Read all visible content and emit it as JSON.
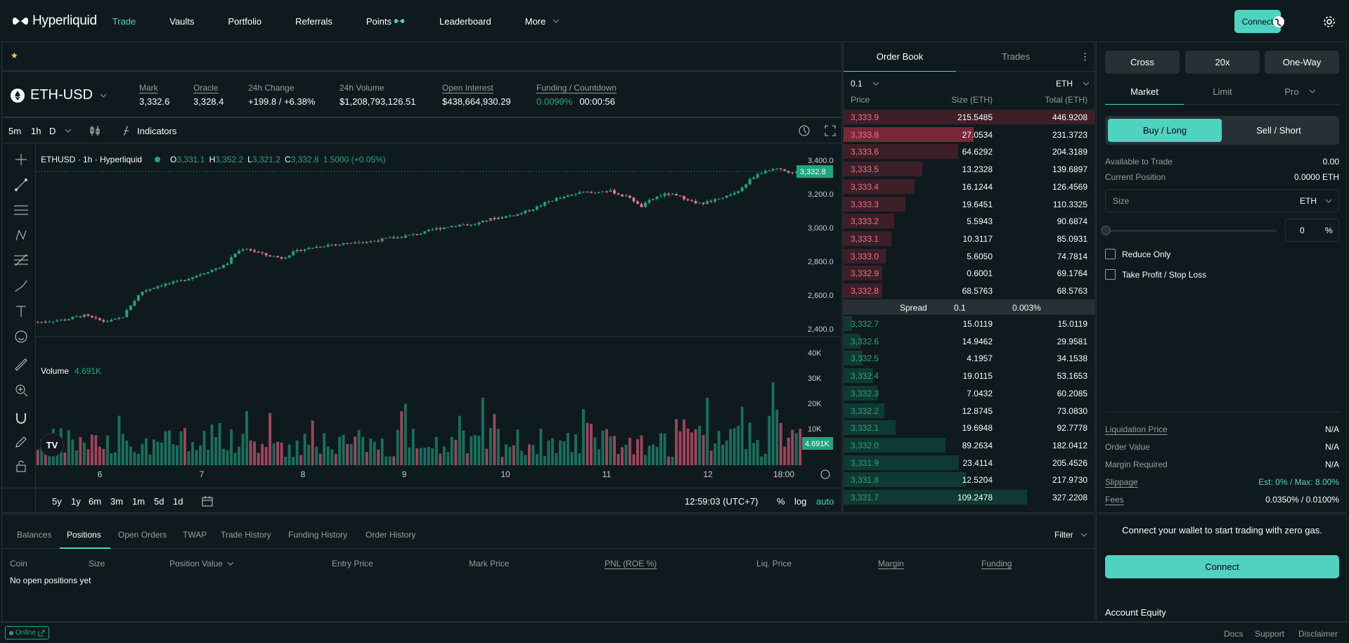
{
  "nav": {
    "brand": "Hyperliquid",
    "links": [
      "Trade",
      "Vaults",
      "Portfolio",
      "Referrals",
      "Points",
      "Leaderboard",
      "More"
    ],
    "connect": "Connect"
  },
  "market": {
    "symbol": "ETH-USD",
    "stats": [
      {
        "label": "Mark",
        "value": "3,332.6"
      },
      {
        "label": "Oracle",
        "value": "3,328.4"
      },
      {
        "label": "24h Change",
        "value": "+199.8 / +6.38%"
      },
      {
        "label": "24h Volume",
        "value": "$1,208,793,126.51"
      },
      {
        "label": "Open Interest",
        "value": "$438,664,930.29"
      },
      {
        "label": "Funding / Countdown",
        "value": "0.0099%",
        "value2": "00:00:56"
      }
    ]
  },
  "chart": {
    "intervals": [
      "5m",
      "1h",
      "D"
    ],
    "indicators": "Indicators",
    "legend": {
      "title": "ETHUSD · 1h · Hyperliquid",
      "o": "3,331.1",
      "h": "3,352.2",
      "l": "3,321.2",
      "c": "3,332.8",
      "chg": "1.5000 (+0.05%)"
    },
    "price_ticks": [
      "3,400.0",
      "3,200.0",
      "3,000.0",
      "2,800.0",
      "2,600.0",
      "2,400.0"
    ],
    "last_price": "3,332.8",
    "volume_label": "Volume",
    "volume_value": "4.691K",
    "vol_ticks": [
      "40K",
      "30K",
      "20K",
      "10K"
    ],
    "last_vol": "4.691K",
    "x_ticks": [
      "6",
      "7",
      "8",
      "9",
      "10",
      "11",
      "12",
      "18:00"
    ],
    "ranges": [
      "5y",
      "1y",
      "6m",
      "3m",
      "1m",
      "5d",
      "1d"
    ],
    "clock": "12:59:03 (UTC+7)",
    "pct": "%",
    "log": "log",
    "auto": "auto"
  },
  "chart_data": {
    "type": "candlestick",
    "x_ticks": [
      "6",
      "7",
      "8",
      "9",
      "10",
      "11",
      "12"
    ],
    "ylim": [
      2400,
      3400
    ],
    "close_path": [
      2440,
      2445,
      2450,
      2455,
      2470,
      2480,
      2460,
      2445,
      2450,
      2470,
      2550,
      2620,
      2640,
      2660,
      2670,
      2680,
      2700,
      2720,
      2740,
      2760,
      2780,
      2850,
      2880,
      2860,
      2840,
      2830,
      2820,
      2850,
      2870,
      2880,
      2890,
      2900,
      2900,
      2910,
      2920,
      2915,
      2925,
      2935,
      2940,
      2950,
      2960,
      2970,
      2990,
      3000,
      3010,
      3020,
      3015,
      3030,
      3050,
      3060,
      3070,
      3080,
      3100,
      3120,
      3150,
      3170,
      3180,
      3200,
      3210,
      3205,
      3220,
      3215,
      3190,
      3180,
      3120,
      3160,
      3190,
      3200,
      3185,
      3170,
      3140,
      3150,
      3170,
      3180,
      3200,
      3250,
      3300,
      3330,
      3350,
      3340,
      3330,
      3332
    ]
  },
  "orderbook": {
    "tabs": [
      "Order Book",
      "Trades"
    ],
    "tick": "0.1",
    "unit": "ETH",
    "headers": [
      "Price",
      "Size (ETH)",
      "Total (ETH)"
    ],
    "asks": [
      [
        "3,333.9",
        "215.5485",
        "446.9208"
      ],
      [
        "3,333.8",
        "27.0534",
        "231.3723"
      ],
      [
        "3,333.6",
        "64.6292",
        "204.3189"
      ],
      [
        "3,333.5",
        "13.2328",
        "139.6897"
      ],
      [
        "3,333.4",
        "16.1244",
        "126.4569"
      ],
      [
        "3,333.3",
        "19.6451",
        "110.3325"
      ],
      [
        "3,333.2",
        "5.5943",
        "90.6874"
      ],
      [
        "3,333.1",
        "10.3117",
        "85.0931"
      ],
      [
        "3,333.0",
        "5.6050",
        "74.7814"
      ],
      [
        "3,332.9",
        "0.6001",
        "69.1764"
      ],
      [
        "3,332.8",
        "68.5763",
        "68.5763"
      ]
    ],
    "spread": [
      "Spread",
      "0.1",
      "0.003%"
    ],
    "bids": [
      [
        "3,332.7",
        "15.0119",
        "15.0119"
      ],
      [
        "3,332.6",
        "14.9462",
        "29.9581"
      ],
      [
        "3,332.5",
        "4.1957",
        "34.1538"
      ],
      [
        "3,332.4",
        "19.0115",
        "53.1653"
      ],
      [
        "3,332.3",
        "7.0432",
        "60.2085"
      ],
      [
        "3,332.2",
        "12.8745",
        "73.0830"
      ],
      [
        "3,332.1",
        "19.6948",
        "92.7778"
      ],
      [
        "3,332.0",
        "89.2634",
        "182.0412"
      ],
      [
        "3,331.9",
        "23.4114",
        "205.4526"
      ],
      [
        "3,331.8",
        "12.5204",
        "217.9730"
      ],
      [
        "3,331.7",
        "109.2478",
        "327.2208"
      ]
    ]
  },
  "trade": {
    "margin": [
      "Cross",
      "20x",
      "One-Way"
    ],
    "types": [
      "Market",
      "Limit",
      "Pro"
    ],
    "sides": [
      "Buy / Long",
      "Sell / Short"
    ],
    "available_label": "Available to Trade",
    "available": "0.00",
    "position_label": "Current Position",
    "position": "0.0000 ETH",
    "size_placeholder": "Size",
    "size_unit": "ETH",
    "pct_value": "0",
    "pct_unit": "%",
    "reduce": "Reduce Only",
    "tpsl": "Take Profit / Stop Loss",
    "info": [
      [
        "Liquidation Price",
        "N/A"
      ],
      [
        "Order Value",
        "N/A"
      ],
      [
        "Margin Required",
        "N/A"
      ],
      [
        "Slippage",
        "Est: 0% / Max: 8.00%"
      ],
      [
        "Fees",
        "0.0350% / 0.0100%"
      ]
    ]
  },
  "bottom": {
    "tabs": [
      "Balances",
      "Positions",
      "Open Orders",
      "TWAP",
      "Trade History",
      "Funding History",
      "Order History"
    ],
    "filter": "Filter",
    "headers": [
      "Coin",
      "Size",
      "Position Value",
      "Entry Price",
      "Mark Price",
      "PNL (ROE %)",
      "Liq. Price",
      "Margin",
      "Funding"
    ],
    "empty": "No open positions yet"
  },
  "account": {
    "msg": "Connect your wallet to start trading with zero gas.",
    "connect": "Connect",
    "equity": "Account Equity"
  },
  "footer": {
    "status": "Online",
    "links": [
      "Docs",
      "Support",
      "Disclaimer"
    ]
  }
}
